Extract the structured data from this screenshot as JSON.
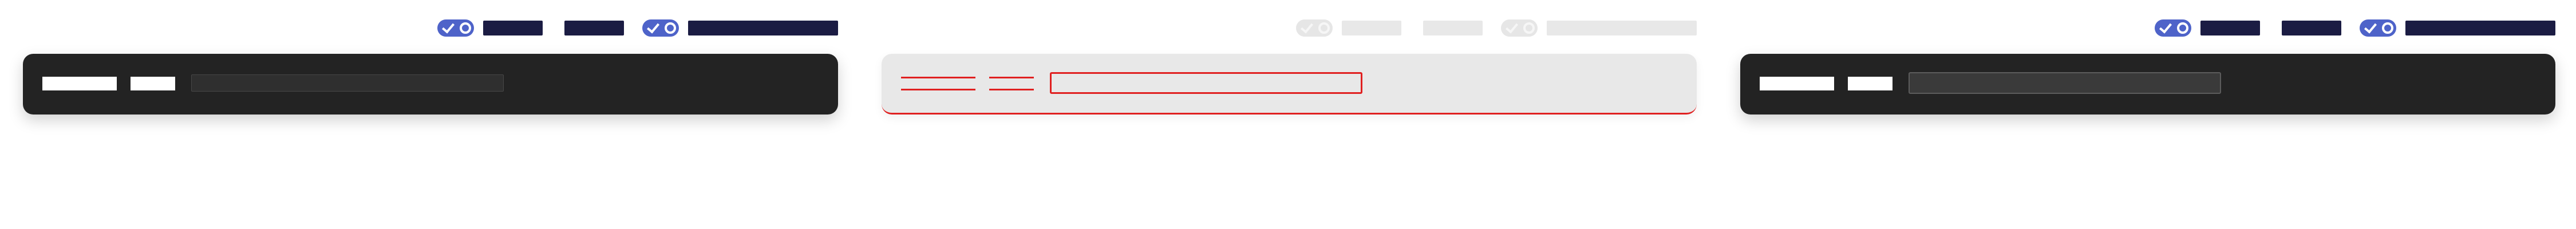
{
  "colors": {
    "accent": "#4e63c9",
    "label_dark": "#1b1c43",
    "bar_dark": "#232323",
    "bar_disabled": "#e8e8e8",
    "error": "#e02020"
  },
  "panels": [
    {
      "state": "enabled",
      "toggles": [
        {
          "icon": "check-icon",
          "on": true
        },
        {
          "icon": "check-icon",
          "on": true
        }
      ]
    },
    {
      "state": "disabled-error",
      "toggles": [
        {
          "icon": "check-icon",
          "on": false
        },
        {
          "icon": "check-icon",
          "on": false
        }
      ]
    },
    {
      "state": "enabled",
      "toggles": [
        {
          "icon": "check-icon",
          "on": true
        },
        {
          "icon": "check-icon",
          "on": true
        }
      ]
    }
  ]
}
